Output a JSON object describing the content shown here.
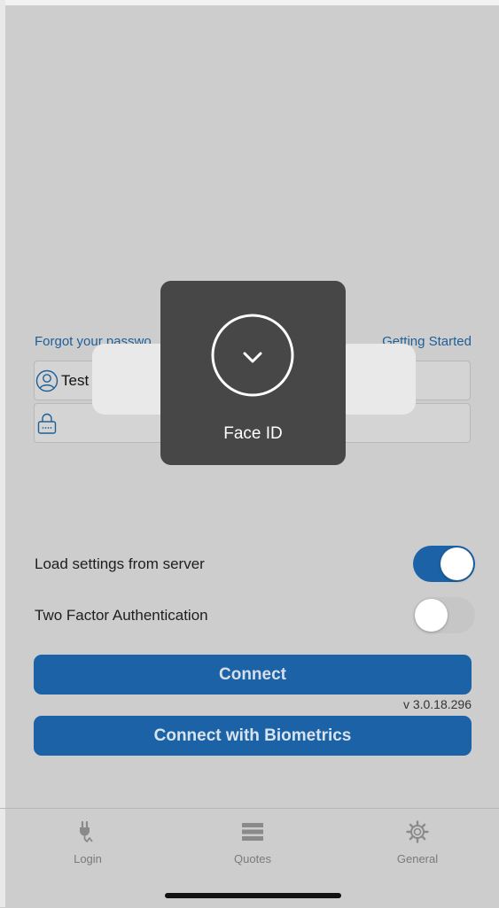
{
  "links": {
    "forgot_password": "Forgot your passwo",
    "getting_started": "Getting Started"
  },
  "fields": {
    "username_value": "Test",
    "password_value": ""
  },
  "face_id": {
    "label": "Face ID"
  },
  "settings": {
    "load_settings_label": "Load settings from server",
    "load_settings_on": true,
    "two_factor_label": "Two Factor Authentication",
    "two_factor_on": false
  },
  "buttons": {
    "connect": "Connect",
    "connect_biometrics": "Connect with Biometrics"
  },
  "version": "v 3.0.18.296",
  "tabs": [
    {
      "label": "Login",
      "icon": "plug-icon"
    },
    {
      "label": "Quotes",
      "icon": "list-icon"
    },
    {
      "label": "General",
      "icon": "gear-icon"
    }
  ],
  "colors": {
    "accent": "#1b62a6",
    "link": "#1f5f98",
    "background": "#cdcdcd",
    "face_id_panel": "#474747"
  }
}
